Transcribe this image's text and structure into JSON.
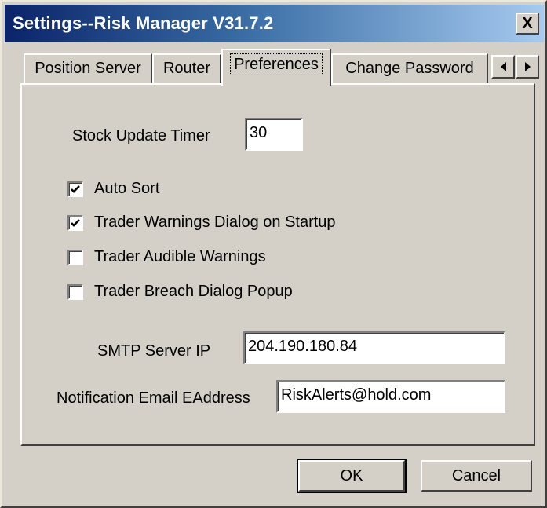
{
  "window": {
    "title": "Settings--Risk Manager V31.7.2",
    "close_glyph": "X"
  },
  "tabs": [
    {
      "label": "Position Server",
      "active": false
    },
    {
      "label": "Router",
      "active": false
    },
    {
      "label": "Preferences",
      "active": true
    },
    {
      "label": "Change Password",
      "active": false
    }
  ],
  "tab_scroll": {
    "left_icon": "scroll-left-icon",
    "right_icon": "scroll-right-icon"
  },
  "preferences": {
    "stock_update_timer_label": "Stock Update Timer",
    "stock_update_timer_value": "30",
    "checkboxes": [
      {
        "label": "Auto Sort",
        "checked": true
      },
      {
        "label": "Trader Warnings Dialog on Startup",
        "checked": true
      },
      {
        "label": "Trader Audible Warnings",
        "checked": false
      },
      {
        "label": "Trader Breach Dialog Popup",
        "checked": false
      }
    ],
    "smtp_label": "SMTP Server IP",
    "smtp_value": "204.190.180.84",
    "email_label": "Notification Email EAddress",
    "email_value": "RiskAlerts@hold.com"
  },
  "buttons": {
    "ok": "OK",
    "cancel": "Cancel"
  },
  "colors": {
    "dialog_face": "#d4d0c8",
    "titlebar_start": "#0a246a",
    "titlebar_end": "#a6caf0",
    "title_text": "#ffffff"
  }
}
